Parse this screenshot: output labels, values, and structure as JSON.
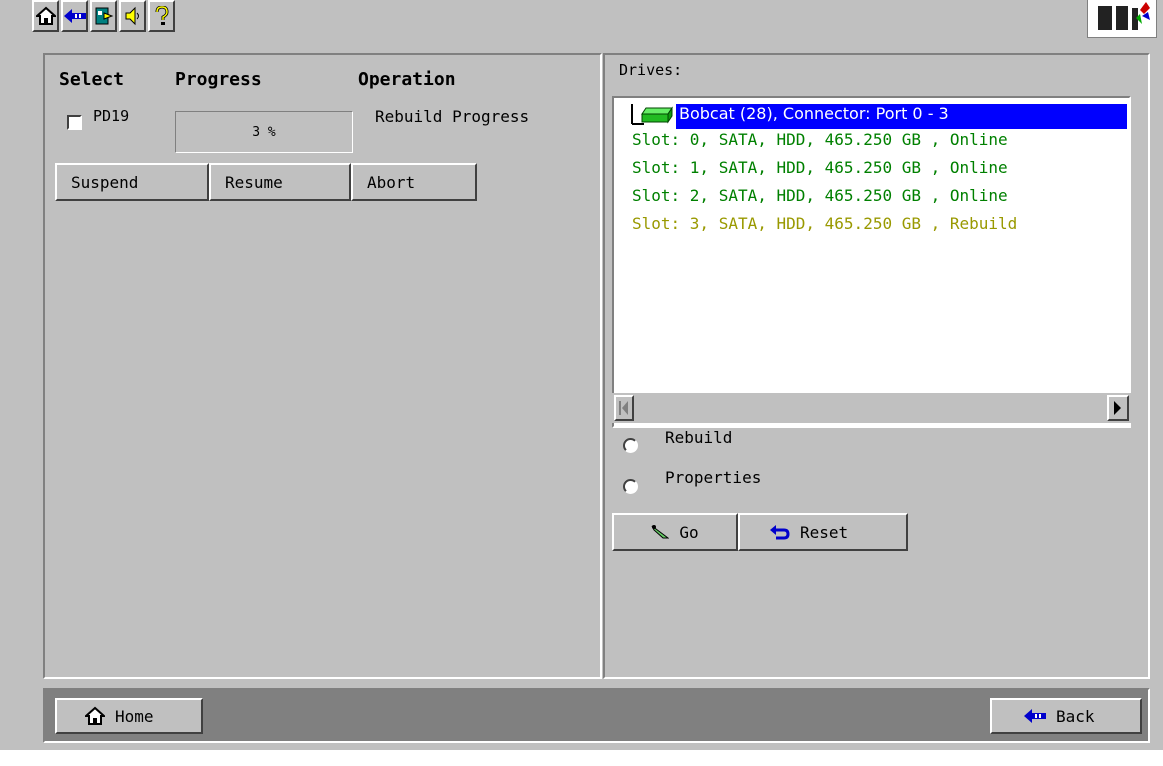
{
  "toolbar": {
    "icons": [
      "home-icon",
      "back-arrow-icon",
      "exit-icon",
      "speaker-icon",
      "help-icon"
    ]
  },
  "left": {
    "headers": {
      "select": "Select",
      "progress": "Progress",
      "operation": "Operation"
    },
    "row": {
      "label": "PD19",
      "progress": "3 %",
      "operation": "Rebuild Progress"
    },
    "buttons": {
      "suspend": "Suspend",
      "resume": "Resume",
      "abort": "Abort"
    }
  },
  "right": {
    "drives_label": "Drives:",
    "enclosure": "Bobcat (28), Connector: Port 0 - 3",
    "slots": [
      {
        "text": "Slot: 0, SATA, HDD, 465.250 GB , Online",
        "color": "#008000"
      },
      {
        "text": "Slot: 1, SATA, HDD, 465.250 GB , Online",
        "color": "#008000"
      },
      {
        "text": "Slot: 2, SATA, HDD, 465.250 GB , Online",
        "color": "#008000"
      },
      {
        "text": "Slot: 3, SATA, HDD, 465.250 GB , Rebuild",
        "color": "#999900"
      }
    ],
    "options": {
      "rebuild": "Rebuild",
      "properties": "Properties"
    },
    "buttons": {
      "go": "Go",
      "reset": "Reset"
    }
  },
  "footer": {
    "home": "Home",
    "back": "Back"
  },
  "colors": {
    "selection": "#0000ff",
    "online": "#008000",
    "rebuild": "#999900",
    "panel": "#c0c0c0"
  }
}
